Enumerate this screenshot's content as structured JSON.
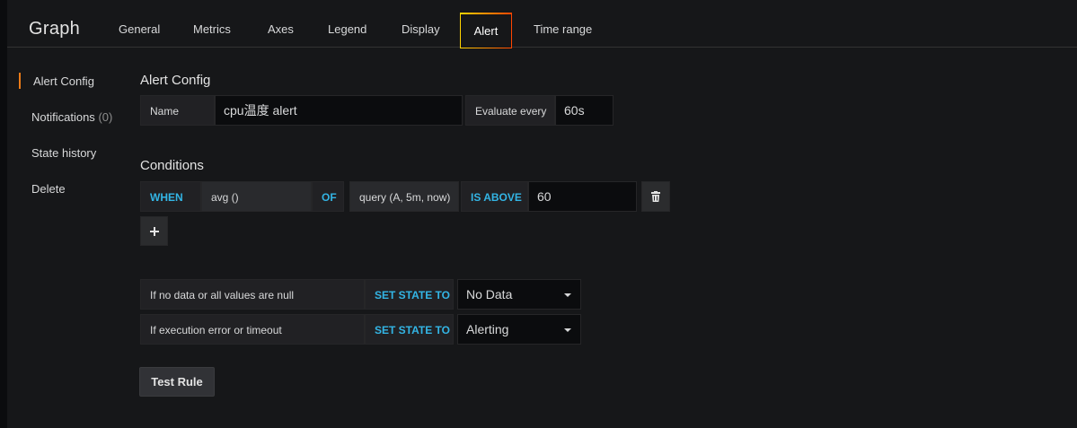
{
  "panel": {
    "title": "Graph"
  },
  "tabs": [
    {
      "label": "General"
    },
    {
      "label": "Metrics"
    },
    {
      "label": "Axes"
    },
    {
      "label": "Legend"
    },
    {
      "label": "Display"
    },
    {
      "label": "Alert",
      "active": true
    },
    {
      "label": "Time range"
    }
  ],
  "sidebar": {
    "items": [
      {
        "label": "Alert Config",
        "active": true
      },
      {
        "label": "Notifications",
        "count": "(0)"
      },
      {
        "label": "State history"
      },
      {
        "label": "Delete"
      }
    ]
  },
  "alert_config": {
    "title": "Alert Config",
    "name_label": "Name",
    "name_value": "cpu温度 alert",
    "evaluate_label": "Evaluate every",
    "evaluate_value": "60s"
  },
  "conditions": {
    "title": "Conditions",
    "when_keyword": "WHEN",
    "reducer": "avg ()",
    "of_keyword": "OF",
    "query": "query (A, 5m, now)",
    "evaluator": "IS ABOVE",
    "threshold": "60",
    "add_icon": "plus-icon",
    "remove_icon": "trash-icon"
  },
  "no_data": {
    "label": "If no data or all values are null",
    "keyword": "SET STATE TO",
    "value": "No Data"
  },
  "exec_error": {
    "label": "If execution error or timeout",
    "keyword": "SET STATE TO",
    "value": "Alerting"
  },
  "actions": {
    "test_rule": "Test Rule"
  },
  "colors": {
    "accent_keyword": "#33b5e5",
    "active_marker": "#eb7b18",
    "tab_gradient_start": "#ffd500",
    "tab_gradient_end": "#ff4400"
  }
}
